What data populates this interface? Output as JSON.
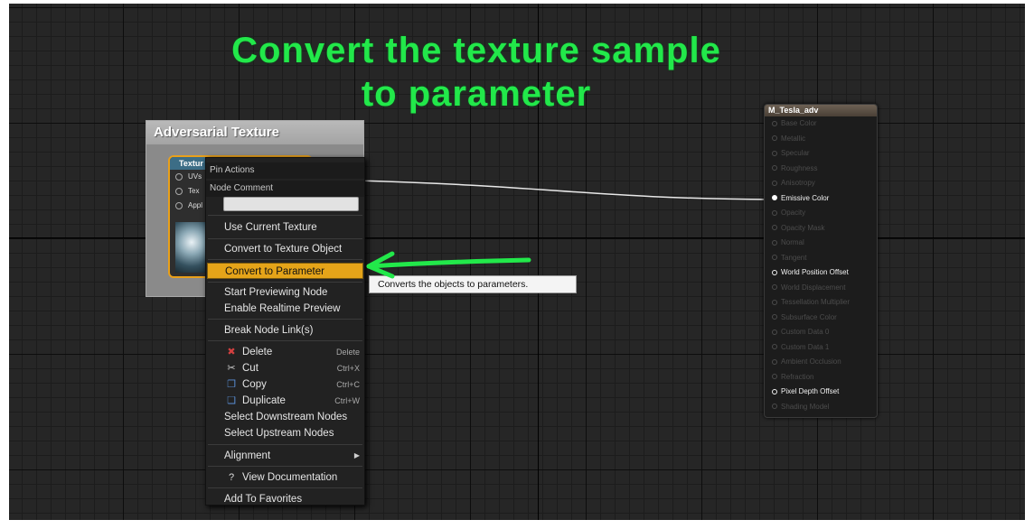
{
  "headline": {
    "line1": "Convert the texture sample",
    "line2": "to parameter",
    "color": "#22e84a"
  },
  "comment_box": {
    "title": "Adversarial Texture"
  },
  "texture_node": {
    "title": "Textur",
    "pins": [
      "UVs",
      "Tex",
      "Appl"
    ]
  },
  "material_node": {
    "title": "M_Tesla_adv",
    "pins": [
      {
        "label": "Base Color",
        "state": "dim"
      },
      {
        "label": "Metallic",
        "state": "dim"
      },
      {
        "label": "Specular",
        "state": "dim"
      },
      {
        "label": "Roughness",
        "state": "dim"
      },
      {
        "label": "Anisotropy",
        "state": "dim"
      },
      {
        "label": "Emissive Color",
        "state": "connected"
      },
      {
        "label": "Opacity",
        "state": "dim"
      },
      {
        "label": "Opacity Mask",
        "state": "dim"
      },
      {
        "label": "Normal",
        "state": "dim"
      },
      {
        "label": "Tangent",
        "state": "dim"
      },
      {
        "label": "World Position Offset",
        "state": "lit"
      },
      {
        "label": "World Displacement",
        "state": "dim"
      },
      {
        "label": "Tessellation Multiplier",
        "state": "dim"
      },
      {
        "label": "Subsurface Color",
        "state": "dim"
      },
      {
        "label": "Custom Data 0",
        "state": "dim"
      },
      {
        "label": "Custom Data 1",
        "state": "dim"
      },
      {
        "label": "Ambient Occlusion",
        "state": "dim"
      },
      {
        "label": "Refraction",
        "state": "dim"
      },
      {
        "label": "Pixel Depth Offset",
        "state": "lit"
      },
      {
        "label": "Shading Model",
        "state": "dim"
      }
    ]
  },
  "context_menu": {
    "pin_actions_header": "Pin Actions",
    "node_comment_header": "Node Comment",
    "items": {
      "use_current_texture": "Use Current Texture",
      "convert_to_texture_object": "Convert to Texture Object",
      "convert_to_parameter": "Convert to Parameter",
      "start_previewing_node": "Start Previewing Node",
      "enable_realtime_preview": "Enable Realtime Preview",
      "break_node_links": "Break Node Link(s)",
      "delete": "Delete",
      "delete_shortcut": "Delete",
      "cut": "Cut",
      "cut_shortcut": "Ctrl+X",
      "copy": "Copy",
      "copy_shortcut": "Ctrl+C",
      "duplicate": "Duplicate",
      "duplicate_shortcut": "Ctrl+W",
      "select_downstream": "Select Downstream Nodes",
      "select_upstream": "Select Upstream Nodes",
      "alignment": "Alignment",
      "view_documentation": "View Documentation",
      "add_to_favorites": "Add To Favorites"
    },
    "highlight_color": "#e5a419"
  },
  "tooltip": {
    "text": "Converts the objects to parameters."
  },
  "annotation_arrow_color": "#22e84a"
}
